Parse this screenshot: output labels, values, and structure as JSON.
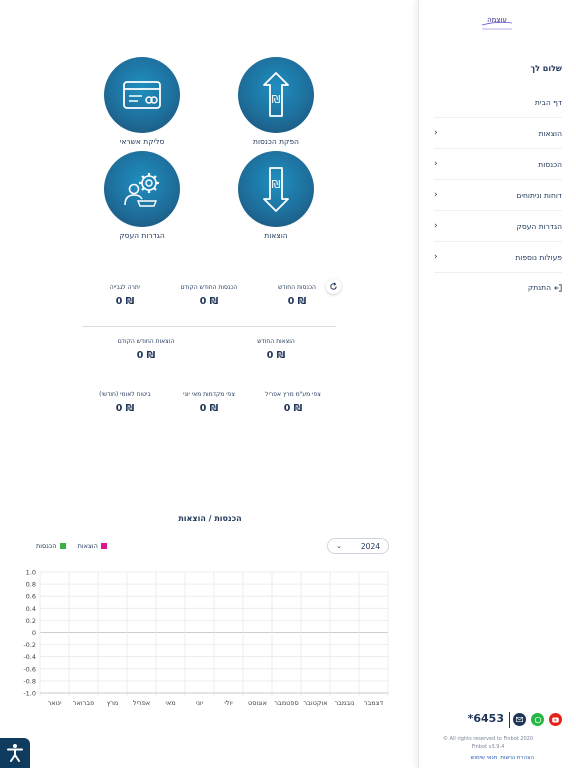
{
  "sidebar": {
    "logo_text": "עוצמה",
    "greeting": "שלום לך",
    "nav": [
      {
        "label": "דף הבית",
        "chevron": false
      },
      {
        "label": "הוצאות",
        "chevron": true
      },
      {
        "label": "הכנסות",
        "chevron": true
      },
      {
        "label": "דוחות וניתוחים",
        "chevron": true
      },
      {
        "label": "הגדרות העסק",
        "chevron": true
      },
      {
        "label": "פעולות נוספות",
        "chevron": true
      }
    ],
    "logout": "התנתק",
    "phone": "6453*",
    "rights_line1": "All rights reserved to Finbot 2020 ©",
    "rights_line2": "Finbot v3.9.4",
    "terms": "תנאי שימוש",
    "accessibility_statement": "הצהרת נגישות"
  },
  "actions": [
    {
      "label": "הפקת הכנסות",
      "icon": "income-arrow-up-shekel-icon"
    },
    {
      "label": "סליקת אשראי",
      "icon": "credit-card-icon"
    },
    {
      "label": "הוצאות",
      "icon": "expense-arrow-down-shekel-icon"
    },
    {
      "label": "הגדרות העסק",
      "icon": "business-settings-gear-icon"
    }
  ],
  "stats": {
    "income_month": {
      "title": "הכנסות החודש",
      "value": "₪ 0"
    },
    "income_prev": {
      "title": "הכנסות החודש הקודם",
      "value": "₪ 0"
    },
    "balance": {
      "title": "יתרה לגבייה",
      "value": "₪ 0"
    },
    "expense_month": {
      "title": "הוצאות החודש",
      "value": "₪ 0"
    },
    "expense_prev": {
      "title": "הוצאות החודש הקודם",
      "value": "₪ 0"
    },
    "vat": {
      "title": "צפי מע\"מ מרץ אפריל",
      "value": "₪ 0"
    },
    "advances": {
      "title": "צפי מקדמות מאי יוני",
      "value": "₪ 0"
    },
    "national_ins": {
      "title": "ביטוח לאומי (חודשי)",
      "value": "₪ 0"
    }
  },
  "chart_section": {
    "title": "הכנסות / הוצאות",
    "year": "2024"
  },
  "chart_data": {
    "type": "bar",
    "categories": [
      "ינואר",
      "פברואר",
      "מרץ",
      "אפריל",
      "מאי",
      "יוני",
      "יולי",
      "אוגוסט",
      "ספטמבר",
      "אוקטובר",
      "נובמבר",
      "דצמבר"
    ],
    "series": [
      {
        "name": "הכנסות",
        "color": "#3cb043",
        "values": [
          0,
          0,
          0,
          0,
          0,
          0,
          0,
          0,
          0,
          0,
          0,
          0
        ]
      },
      {
        "name": "הוצאות",
        "color": "#e0148c",
        "values": [
          0,
          0,
          0,
          0,
          0,
          0,
          0,
          0,
          0,
          0,
          0,
          0
        ]
      }
    ],
    "yticks": [
      "1.0",
      "0.8",
      "0.6",
      "0.4",
      "0.2",
      "0",
      "-0.2",
      "-0.4",
      "-0.6",
      "-0.8",
      "-1.0"
    ],
    "ylim": [
      -1,
      1
    ],
    "grid": true,
    "legend": "top-left"
  }
}
